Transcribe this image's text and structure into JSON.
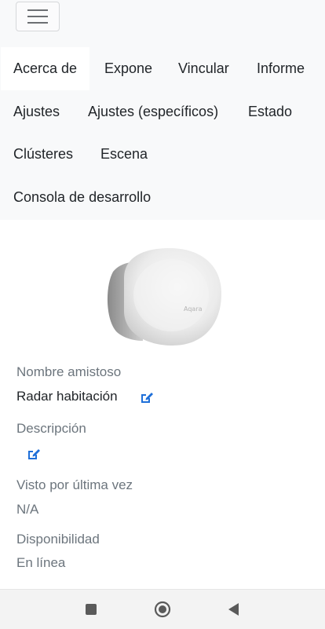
{
  "header": {
    "menu_icon": "hamburger-menu-icon"
  },
  "tabs": [
    {
      "label": "Acerca de",
      "active": true
    },
    {
      "label": "Expone"
    },
    {
      "label": "Vincular"
    },
    {
      "label": "Informe"
    },
    {
      "label": "Ajustes"
    },
    {
      "label": "Ajustes (específicos)"
    },
    {
      "label": "Estado"
    },
    {
      "label": "Clústeres"
    },
    {
      "label": "Escena"
    },
    {
      "label": "Consola de desarrollo"
    }
  ],
  "device": {
    "image": "aqara-device-image",
    "brand_mark": "Aqara"
  },
  "fields": {
    "friendly_name": {
      "label": "Nombre amistoso",
      "value": "Radar habitación",
      "edit_icon": "edit-icon"
    },
    "description": {
      "label": "Descripción",
      "value": "",
      "edit_icon": "edit-icon"
    },
    "last_seen": {
      "label": "Visto por última vez",
      "value": "N/A"
    },
    "availability": {
      "label": "Disponibilidad",
      "value": "En línea"
    }
  },
  "colors": {
    "accent": "#1e6fd9",
    "tab_bar_bg": "#f8f9fa",
    "label_gray": "#6c757d"
  },
  "system_nav": {
    "recents_icon": "square-icon",
    "home_icon": "circle-home-icon",
    "back_icon": "triangle-back-icon"
  }
}
